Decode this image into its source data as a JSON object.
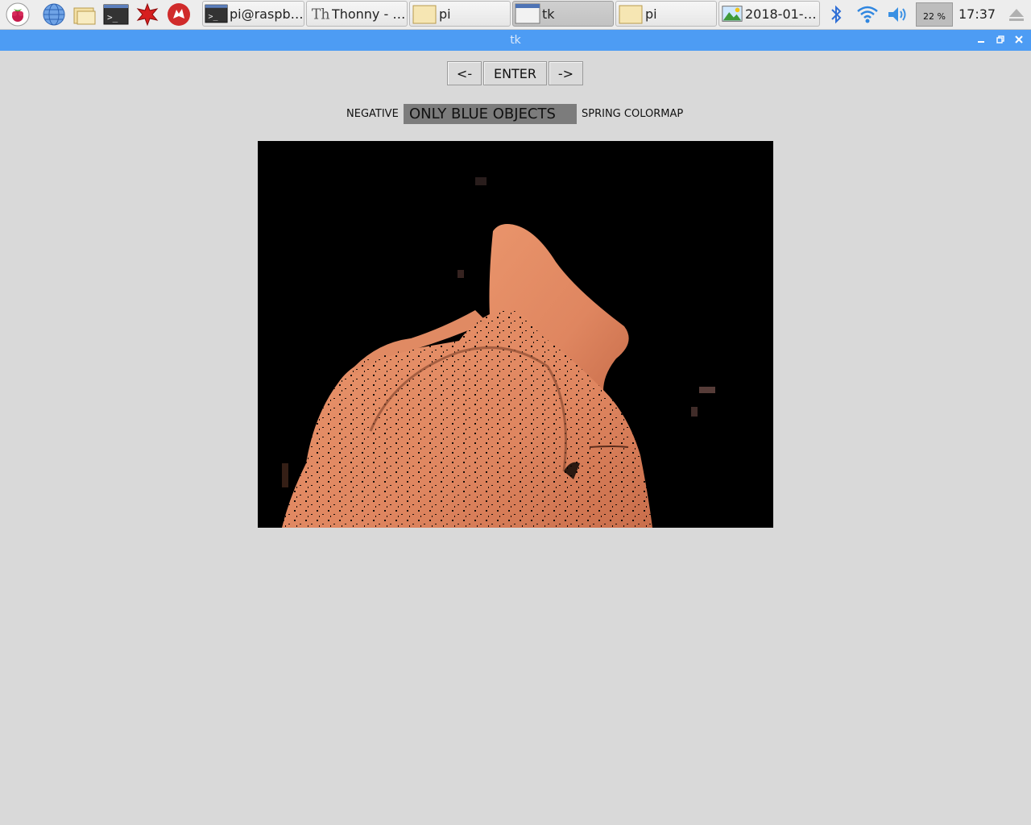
{
  "taskbar": {
    "launchers": [
      {
        "icon": "raspberry-menu-icon"
      },
      {
        "icon": "web-browser-icon"
      },
      {
        "icon": "file-manager-icon"
      },
      {
        "icon": "terminal-icon"
      },
      {
        "icon": "math-kernel-icon"
      },
      {
        "icon": "wolfram-icon"
      }
    ],
    "tasks": [
      {
        "label": "pi@raspbe…",
        "icon": "terminal-icon"
      },
      {
        "label": "Thonny  -  /…",
        "icon": "thonny-icon"
      },
      {
        "label": "pi",
        "icon": "folder-icon"
      },
      {
        "label": "tk",
        "icon": "window-icon",
        "active": true
      },
      {
        "label": "pi",
        "icon": "folder-icon"
      },
      {
        "label": "2018-01-1…",
        "icon": "image-viewer-icon"
      }
    ],
    "tray": {
      "cpu_percent": "22 %",
      "clock": "17:37"
    }
  },
  "window": {
    "title": "tk"
  },
  "controls": {
    "prev_label": "<-",
    "enter_label": "ENTER",
    "next_label": "->"
  },
  "modes": {
    "negative": "NEGATIVE",
    "blue": "ONLY BLUE OBJECTS",
    "spring": "SPRING COLORMAP",
    "selected": "ONLY BLUE OBJECTS"
  },
  "colors": {
    "titlebar": "#4d9cf4",
    "background": "#d9d9d9",
    "selected_mode": "#7c7c7c",
    "jacket": "#e08a63"
  }
}
